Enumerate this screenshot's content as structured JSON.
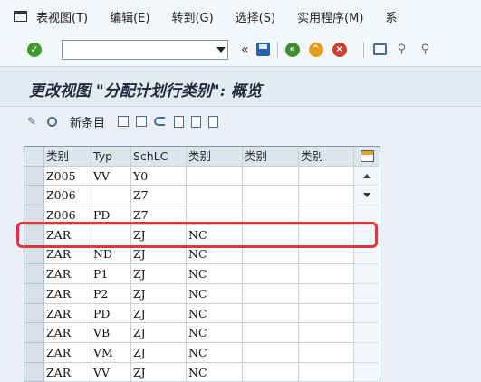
{
  "menu": {
    "items": [
      "表视图(T)",
      "编辑(E)",
      "转到(G)",
      "选择(S)",
      "实用程序(M)",
      "系"
    ]
  },
  "toolbar": {
    "command_value": "",
    "double_arrow": "«"
  },
  "title": "更改视图 \"分配计划行类别\": 概览",
  "app_toolbar": {
    "new_entries": "新条目"
  },
  "table": {
    "headers": [
      "类别",
      "Typ",
      "SchLC",
      "类别",
      "类别",
      "类别"
    ],
    "rows": [
      [
        "Z005",
        "VV",
        "Y0",
        "",
        "",
        ""
      ],
      [
        "Z006",
        "",
        "Z7",
        "",
        "",
        ""
      ],
      [
        "Z006",
        "PD",
        "Z7",
        "",
        "",
        ""
      ],
      [
        "ZAR",
        "",
        "ZJ",
        "NC",
        "",
        ""
      ],
      [
        "ZAR",
        "ND",
        "ZJ",
        "NC",
        "",
        ""
      ],
      [
        "ZAR",
        "P1",
        "ZJ",
        "NC",
        "",
        ""
      ],
      [
        "ZAR",
        "P2",
        "ZJ",
        "NC",
        "",
        ""
      ],
      [
        "ZAR",
        "PD",
        "ZJ",
        "NC",
        "",
        ""
      ],
      [
        "ZAR",
        "VB",
        "ZJ",
        "NC",
        "",
        ""
      ],
      [
        "ZAR",
        "VM",
        "ZJ",
        "NC",
        "",
        ""
      ],
      [
        "ZAR",
        "VV",
        "ZJ",
        "NC",
        "",
        ""
      ]
    ]
  },
  "colors": {
    "highlight": "#e4333a",
    "check_green": "#3f9a2e"
  }
}
